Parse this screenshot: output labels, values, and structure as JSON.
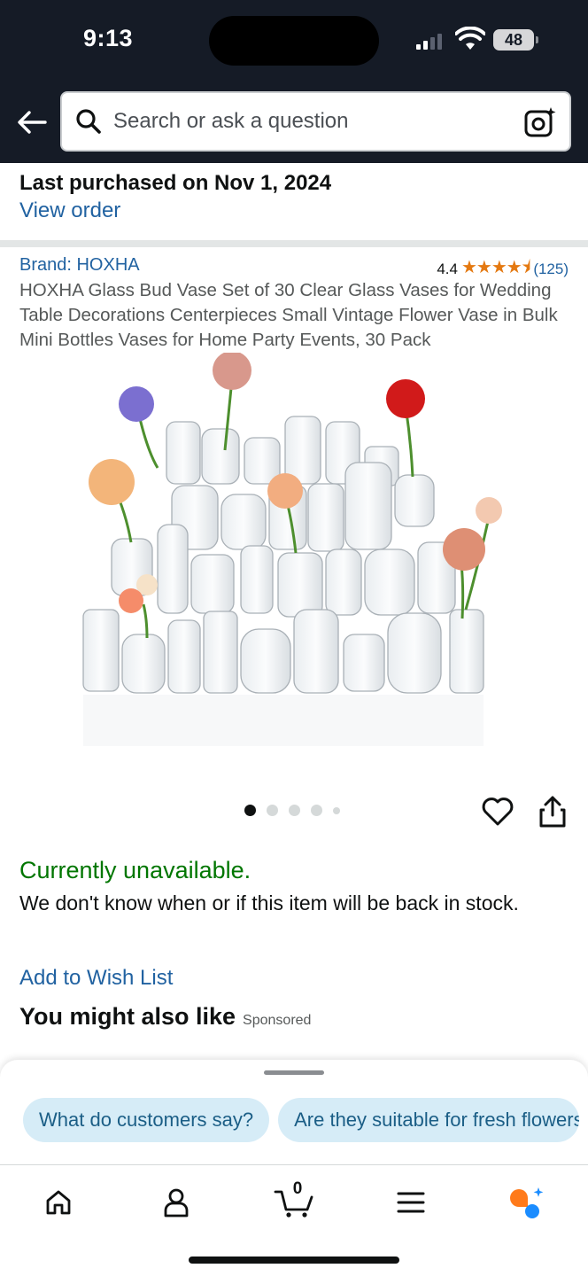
{
  "status_bar": {
    "time": "9:13",
    "battery": "48"
  },
  "header": {
    "search_placeholder": "Search or ask a question",
    "back_icon": "arrow-left-icon",
    "camera_icon": "camera-sparkle-icon"
  },
  "purchase": {
    "last_purchased": "Last purchased on Nov 1, 2024",
    "view_order": "View order"
  },
  "product": {
    "brand": "Brand: HOXHA",
    "rating_value": "4.4",
    "rating_stars": 4.4,
    "stars_text": "★★★★⯨",
    "review_count": "(125)",
    "title": "HOXHA Glass Bud Vase Set of 30 Clear Glass Vases for Wedding Table Decorations Centerpieces Small Vintage Flower Vase in Bulk Mini Bottles Vases for Home Party Events, 30 Pack",
    "image_page": 1,
    "image_pages": 5
  },
  "availability": {
    "status": "Currently unavailable.",
    "message": "We don't know when or if this item will be back in stock."
  },
  "actions": {
    "wishlist": "Add to Wish List"
  },
  "recommendations": {
    "heading": "You might also like",
    "sponsored": "Sponsored"
  },
  "suggestions": {
    "chips": [
      "What do customers say?",
      "Are they suitable for fresh flowers?"
    ]
  },
  "tabbar": {
    "items": [
      "home-icon",
      "account-icon",
      "cart-icon",
      "menu-icon",
      "rufus-assistant-icon"
    ],
    "cart_count": "0"
  },
  "colors": {
    "header_bg": "#151b26",
    "link": "#2162a1",
    "available_green": "#007600",
    "star": "#e47911",
    "chip_bg": "#d6ecf7",
    "chip_text": "#1b5e86"
  }
}
